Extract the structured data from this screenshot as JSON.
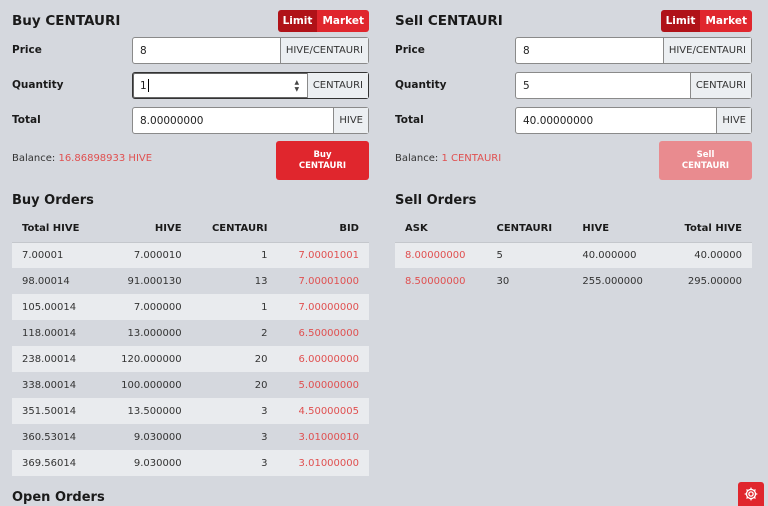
{
  "buy": {
    "title": "Buy CENTAURI",
    "toggle": {
      "limit": "Limit",
      "market": "Market"
    },
    "price_label": "Price",
    "price_value": "8",
    "price_unit": "HIVE/CENTAURI",
    "quantity_label": "Quantity",
    "quantity_value": "1",
    "quantity_unit": "CENTAURI",
    "total_label": "Total",
    "total_value": "8.00000000",
    "total_unit": "HIVE",
    "balance_label": "Balance:",
    "balance_amount": "16.86898933 HIVE",
    "button_line1": "Buy",
    "button_line2": "CENTAURI"
  },
  "sell": {
    "title": "Sell CENTAURI",
    "toggle": {
      "limit": "Limit",
      "market": "Market"
    },
    "price_label": "Price",
    "price_value": "8",
    "price_unit": "HIVE/CENTAURI",
    "quantity_label": "Quantity",
    "quantity_value": "5",
    "quantity_unit": "CENTAURI",
    "total_label": "Total",
    "total_value": "40.00000000",
    "total_unit": "HIVE",
    "balance_label": "Balance:",
    "balance_amount": "1 CENTAURI",
    "button_line1": "Sell",
    "button_line2": "CENTAURI"
  },
  "buy_orders": {
    "title": "Buy Orders",
    "headers": [
      "Total HIVE",
      "HIVE",
      "CENTAURI",
      "BID"
    ],
    "rows": [
      [
        "7.00001",
        "7.000010",
        "1",
        "7.00001001"
      ],
      [
        "98.00014",
        "91.000130",
        "13",
        "7.00001000"
      ],
      [
        "105.00014",
        "7.000000",
        "1",
        "7.00000000"
      ],
      [
        "118.00014",
        "13.000000",
        "2",
        "6.50000000"
      ],
      [
        "238.00014",
        "120.000000",
        "20",
        "6.00000000"
      ],
      [
        "338.00014",
        "100.000000",
        "20",
        "5.00000000"
      ],
      [
        "351.50014",
        "13.500000",
        "3",
        "4.50000005"
      ],
      [
        "360.53014",
        "9.030000",
        "3",
        "3.01000010"
      ],
      [
        "369.56014",
        "9.030000",
        "3",
        "3.01000000"
      ]
    ]
  },
  "sell_orders": {
    "title": "Sell Orders",
    "headers": [
      "ASK",
      "CENTAURI",
      "HIVE",
      "Total HIVE"
    ],
    "rows": [
      [
        "8.00000000",
        "5",
        "40.000000",
        "40.00000"
      ],
      [
        "8.50000000",
        "30",
        "255.000000",
        "295.00000"
      ]
    ]
  },
  "open_orders": {
    "title": "Open Orders"
  },
  "icons": {
    "settings": "gear-icon",
    "spinner": "spinner-arrows-icon"
  },
  "colors": {
    "accent": "#e0262d",
    "accent_dark": "#b01218",
    "price_red": "#e05050",
    "disabled_button": "#e98b8f"
  }
}
